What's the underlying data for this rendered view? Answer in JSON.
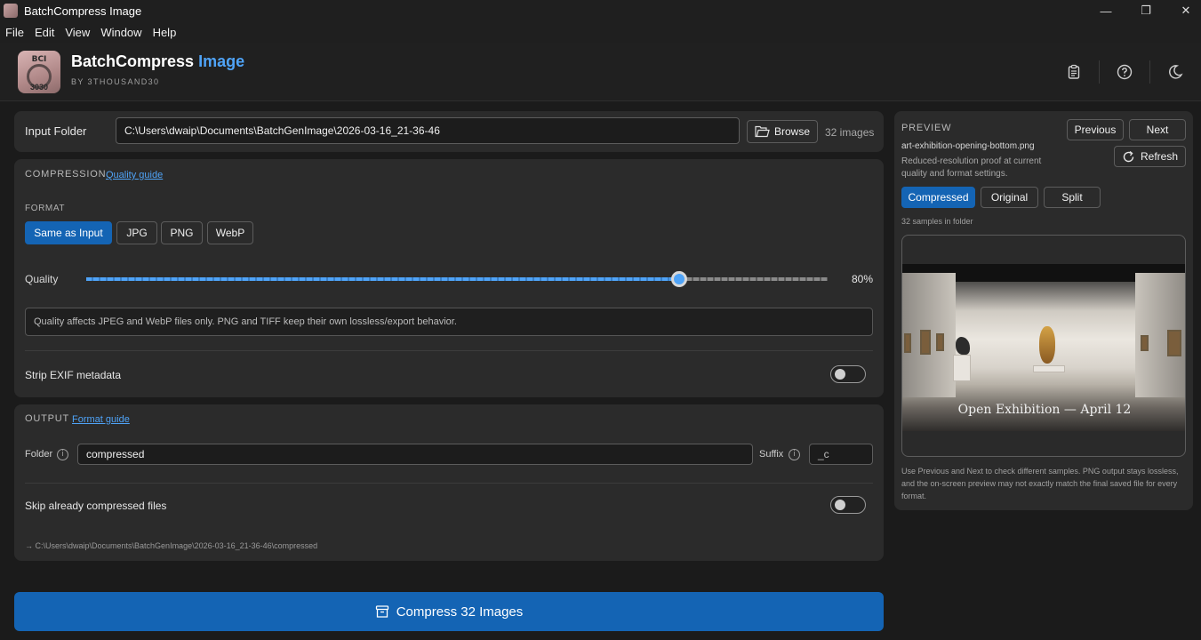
{
  "window": {
    "title": "BatchCompress Image",
    "controls": {
      "minimize": "—",
      "maximize": "❐",
      "close": "✕"
    }
  },
  "menu": [
    "File",
    "Edit",
    "View",
    "Window",
    "Help"
  ],
  "header": {
    "logo": {
      "top": "BCI",
      "bottom": "3030"
    },
    "brand_main": "BatchCompress",
    "brand_accent": "Image",
    "byline": "BY 3THOUSAND30",
    "icons": [
      "clipboard-icon",
      "help-icon",
      "theme-moon-icon"
    ],
    "accent_color": "#4fa3f7"
  },
  "input": {
    "label": "Input Folder",
    "path": "C:\\Users\\dwaip\\Documents\\BatchGenImage\\2026-03-16_21-36-46",
    "browse_label": "Browse",
    "count": "32 images"
  },
  "compression": {
    "heading": "COMPRESSION",
    "guide_link": "Quality guide",
    "format_label": "FORMAT",
    "formats": [
      "Same as Input",
      "JPG",
      "PNG",
      "WebP"
    ],
    "selected_format": "Same as Input",
    "quality_label": "Quality",
    "quality_value": "80%",
    "quality_fraction": 0.8,
    "note": "Quality affects JPEG and WebP files only. PNG and TIFF keep their own lossless/export behavior.",
    "strip_exif_label": "Strip EXIF metadata",
    "strip_exif_on": false
  },
  "output": {
    "heading": "OUTPUT",
    "guide_link": "Format guide",
    "folder_label": "Folder",
    "folder_value": "compressed",
    "suffix_label": "Suffix",
    "suffix_value": "_c",
    "skip_label": "Skip already compressed files",
    "skip_on": false,
    "dest_path": "→ C:\\Users\\dwaip\\Documents\\BatchGenImage\\2026-03-16_21-36-46\\compressed"
  },
  "preview": {
    "heading": "PREVIEW",
    "filename": "art-exhibition-opening-bottom.png",
    "description": "Reduced-resolution proof at current quality and format settings.",
    "previous_label": "Previous",
    "next_label": "Next",
    "refresh_label": "Refresh",
    "modes": [
      "Compressed",
      "Original",
      "Split"
    ],
    "selected_mode": "Compressed",
    "samples": "32 samples in folder",
    "image_caption": "Open Exhibition — April 12",
    "footer": "Use Previous and Next to check different samples. PNG output stays lossless, and the on-screen preview may not exactly match the final saved file for every format."
  },
  "action": {
    "compress_label": "Compress 32 Images",
    "color": "#1464b4"
  }
}
